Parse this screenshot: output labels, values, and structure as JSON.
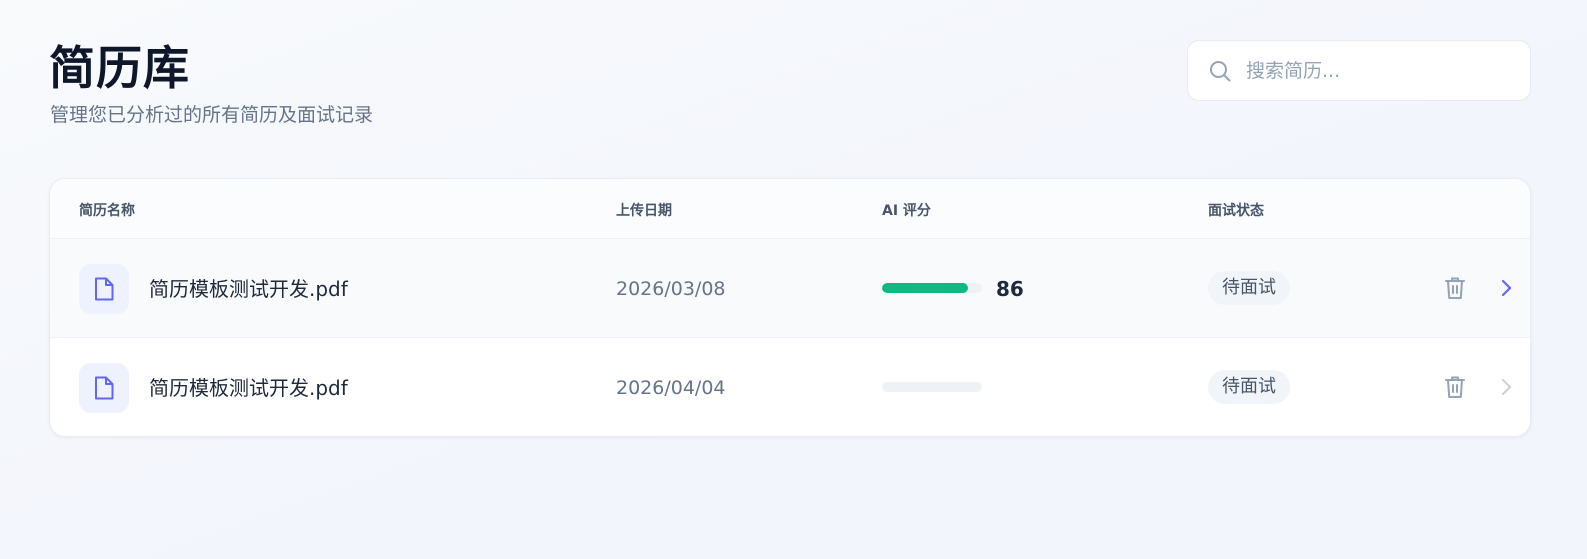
{
  "header": {
    "title": "简历库",
    "subtitle": "管理您已分析过的所有简历及面试记录"
  },
  "search": {
    "placeholder": "搜索简历...",
    "value": "",
    "icon": "search-icon"
  },
  "table": {
    "columns": [
      "简历名称",
      "上传日期",
      "AI 评分",
      "面试状态"
    ],
    "rows": [
      {
        "name": "简历模板测试开发.pdf",
        "date": "2026/03/08",
        "score": "86",
        "score_fraction": 0.86,
        "status": "待面试",
        "icon": "file-icon",
        "actions": [
          "trash-icon",
          "chevron-right-icon"
        ]
      },
      {
        "name": "简历模板测试开发.pdf",
        "date": "2026/04/04",
        "score": "",
        "score_fraction": 0,
        "status": "待面试",
        "icon": "file-icon",
        "actions": [
          "trash-icon",
          "chevron-right-icon"
        ]
      }
    ]
  },
  "colors": {
    "accent": "#6366f1",
    "score_bar": "#10b981",
    "title_text": "#0f172a",
    "muted_text": "#64748b"
  }
}
